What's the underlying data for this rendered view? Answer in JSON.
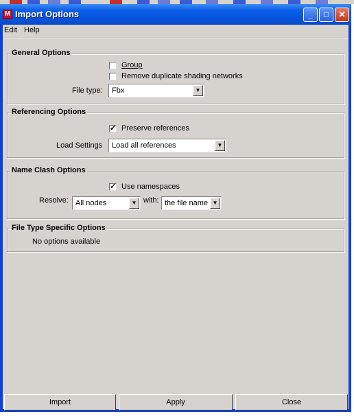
{
  "window": {
    "title": "Import Options",
    "app_icon": "maya-icon",
    "controls": [
      "minimize-icon",
      "maximize-icon",
      "close-icon"
    ]
  },
  "menu": {
    "items": [
      "Edit",
      "Help"
    ]
  },
  "general": {
    "title": "General Options",
    "group_label": "Group",
    "group_checked": false,
    "remove_dup_label": "Remove duplicate shading networks",
    "remove_dup_checked": false,
    "filetype_label": "File type:",
    "filetype_value": "Fbx"
  },
  "referencing": {
    "title": "Referencing Options",
    "preserve_label": "Preserve references",
    "preserve_checked": true,
    "load_label": "Load Settings",
    "load_value": "Load all references"
  },
  "nameclash": {
    "title": "Name Clash Options",
    "namespaces_label": "Use namespaces",
    "namespaces_checked": true,
    "resolve_label": "Resolve:",
    "resolve_value": "All nodes",
    "with_label": "with:",
    "with_value": "the file name"
  },
  "filetype_specific": {
    "title": "File Type Specific Options",
    "message": "No options available"
  },
  "buttons": {
    "import": "Import",
    "apply": "Apply",
    "close": "Close"
  },
  "colors": {
    "titlebar": "#0653dc",
    "client": "#d6d3ce"
  }
}
